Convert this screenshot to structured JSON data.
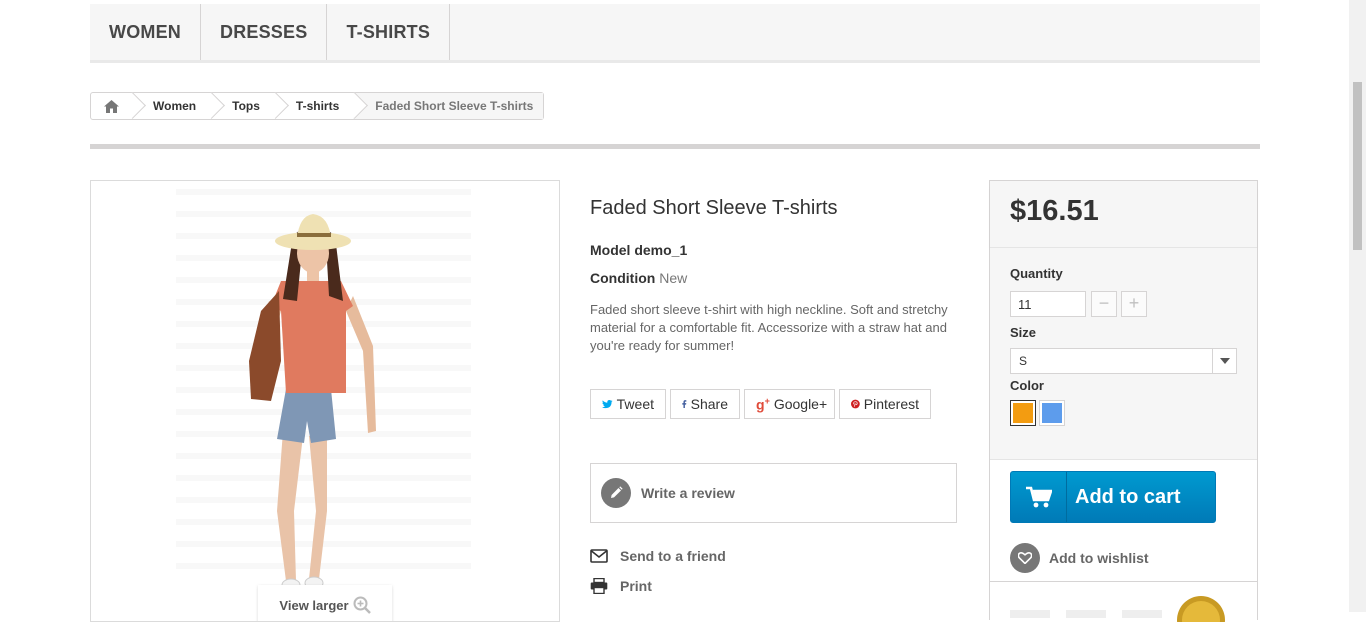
{
  "topmenu": {
    "items": [
      "WOMEN",
      "DRESSES",
      "T-SHIRTS"
    ]
  },
  "breadcrumb": {
    "home_icon": "home-icon",
    "items": [
      "Women",
      "Tops",
      "T-shirts"
    ],
    "current": "Faded Short Sleeve T-shirts"
  },
  "product": {
    "title": "Faded Short Sleeve T-shirts",
    "model_label": "Model",
    "model_value": "demo_1",
    "condition_label": "Condition",
    "condition_value": "New",
    "description": "Faded short sleeve t-shirt with high neckline. Soft and stretchy material for a comfortable fit. Accessorize with a straw hat and you're ready for summer!",
    "view_larger": "View larger"
  },
  "social": {
    "tweet": "Tweet",
    "share": "Share",
    "google": "Google+",
    "pinterest": "Pinterest"
  },
  "review": {
    "label": "Write a review"
  },
  "links": {
    "send_friend": "Send to a friend",
    "print": "Print"
  },
  "buy": {
    "price": "$16.51",
    "quantity_label": "Quantity",
    "quantity_value": "11",
    "size_label": "Size",
    "size_value": "S",
    "color_label": "Color",
    "colors": [
      "#f39c11",
      "#5d9cec"
    ],
    "add_to_cart": "Add to cart",
    "wishlist": "Add to wishlist"
  }
}
